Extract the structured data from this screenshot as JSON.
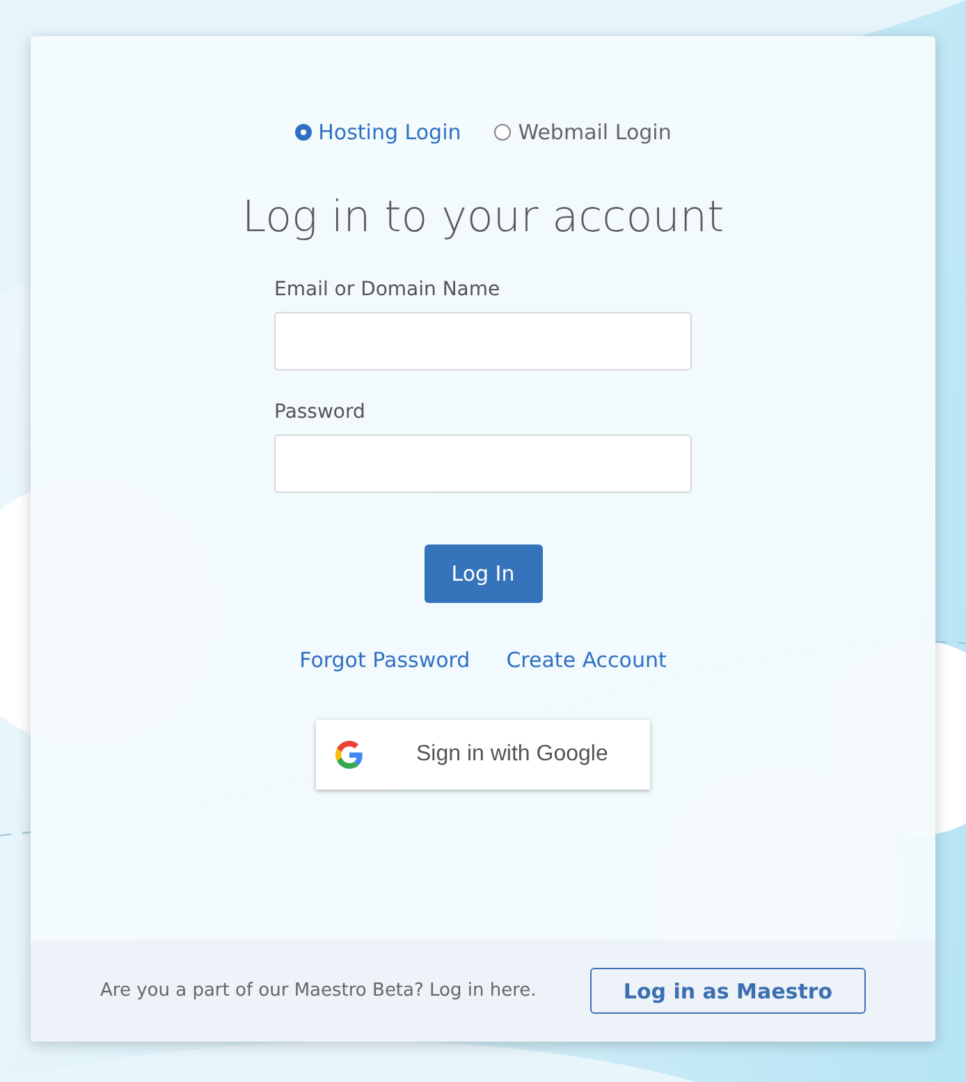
{
  "login_type": [
    {
      "label": "Hosting Login",
      "selected": true
    },
    {
      "label": "Webmail Login",
      "selected": false
    }
  ],
  "heading": "Log in to your account",
  "fields": [
    {
      "label": "Email or Domain Name"
    },
    {
      "label": "Password"
    }
  ],
  "login_button": "Log In",
  "links": [
    "Forgot Password",
    "Create Account"
  ],
  "google_button": "Sign in with Google",
  "footer": {
    "text": "Are you a part of our Maestro Beta? Log in here.",
    "button": "Log in as Maestro"
  }
}
